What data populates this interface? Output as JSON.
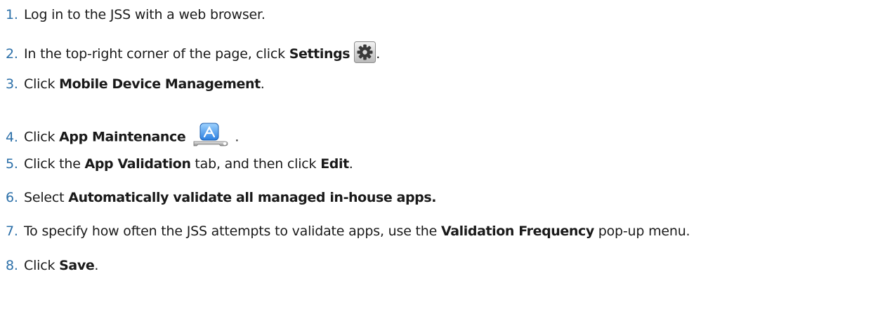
{
  "steps": [
    {
      "num": "1.",
      "text": "Log in to the JSS with a web browser."
    },
    {
      "num": "2.",
      "pre": "In the top-right corner of the page, click ",
      "bold": "Settings",
      "icon": "gear-icon",
      "post": "."
    },
    {
      "num": "3.",
      "pre": "Click ",
      "bold": "Mobile Device Management",
      "post": "."
    },
    {
      "num": "4.",
      "pre": "Click ",
      "bold": "App Maintenance",
      "icon": "app-store-wrench-icon",
      "post": "."
    },
    {
      "num": "5.",
      "pre": "Click the ",
      "bold": "App Validation",
      "mid": " tab, and then click ",
      "bold2": "Edit",
      "post": "."
    },
    {
      "num": "6.",
      "pre": "Select ",
      "bold": "Automatically validate all managed in-house apps."
    },
    {
      "num": "7.",
      "pre": "To specify how often the JSS attempts to validate apps, use the ",
      "bold": "Validation Frequency",
      "post": " pop-up menu."
    },
    {
      "num": "8.",
      "pre": "Click ",
      "bold": "Save",
      "post": "."
    }
  ],
  "colors": {
    "step_number": "#2b6fa8",
    "text": "#1a1a1a"
  }
}
